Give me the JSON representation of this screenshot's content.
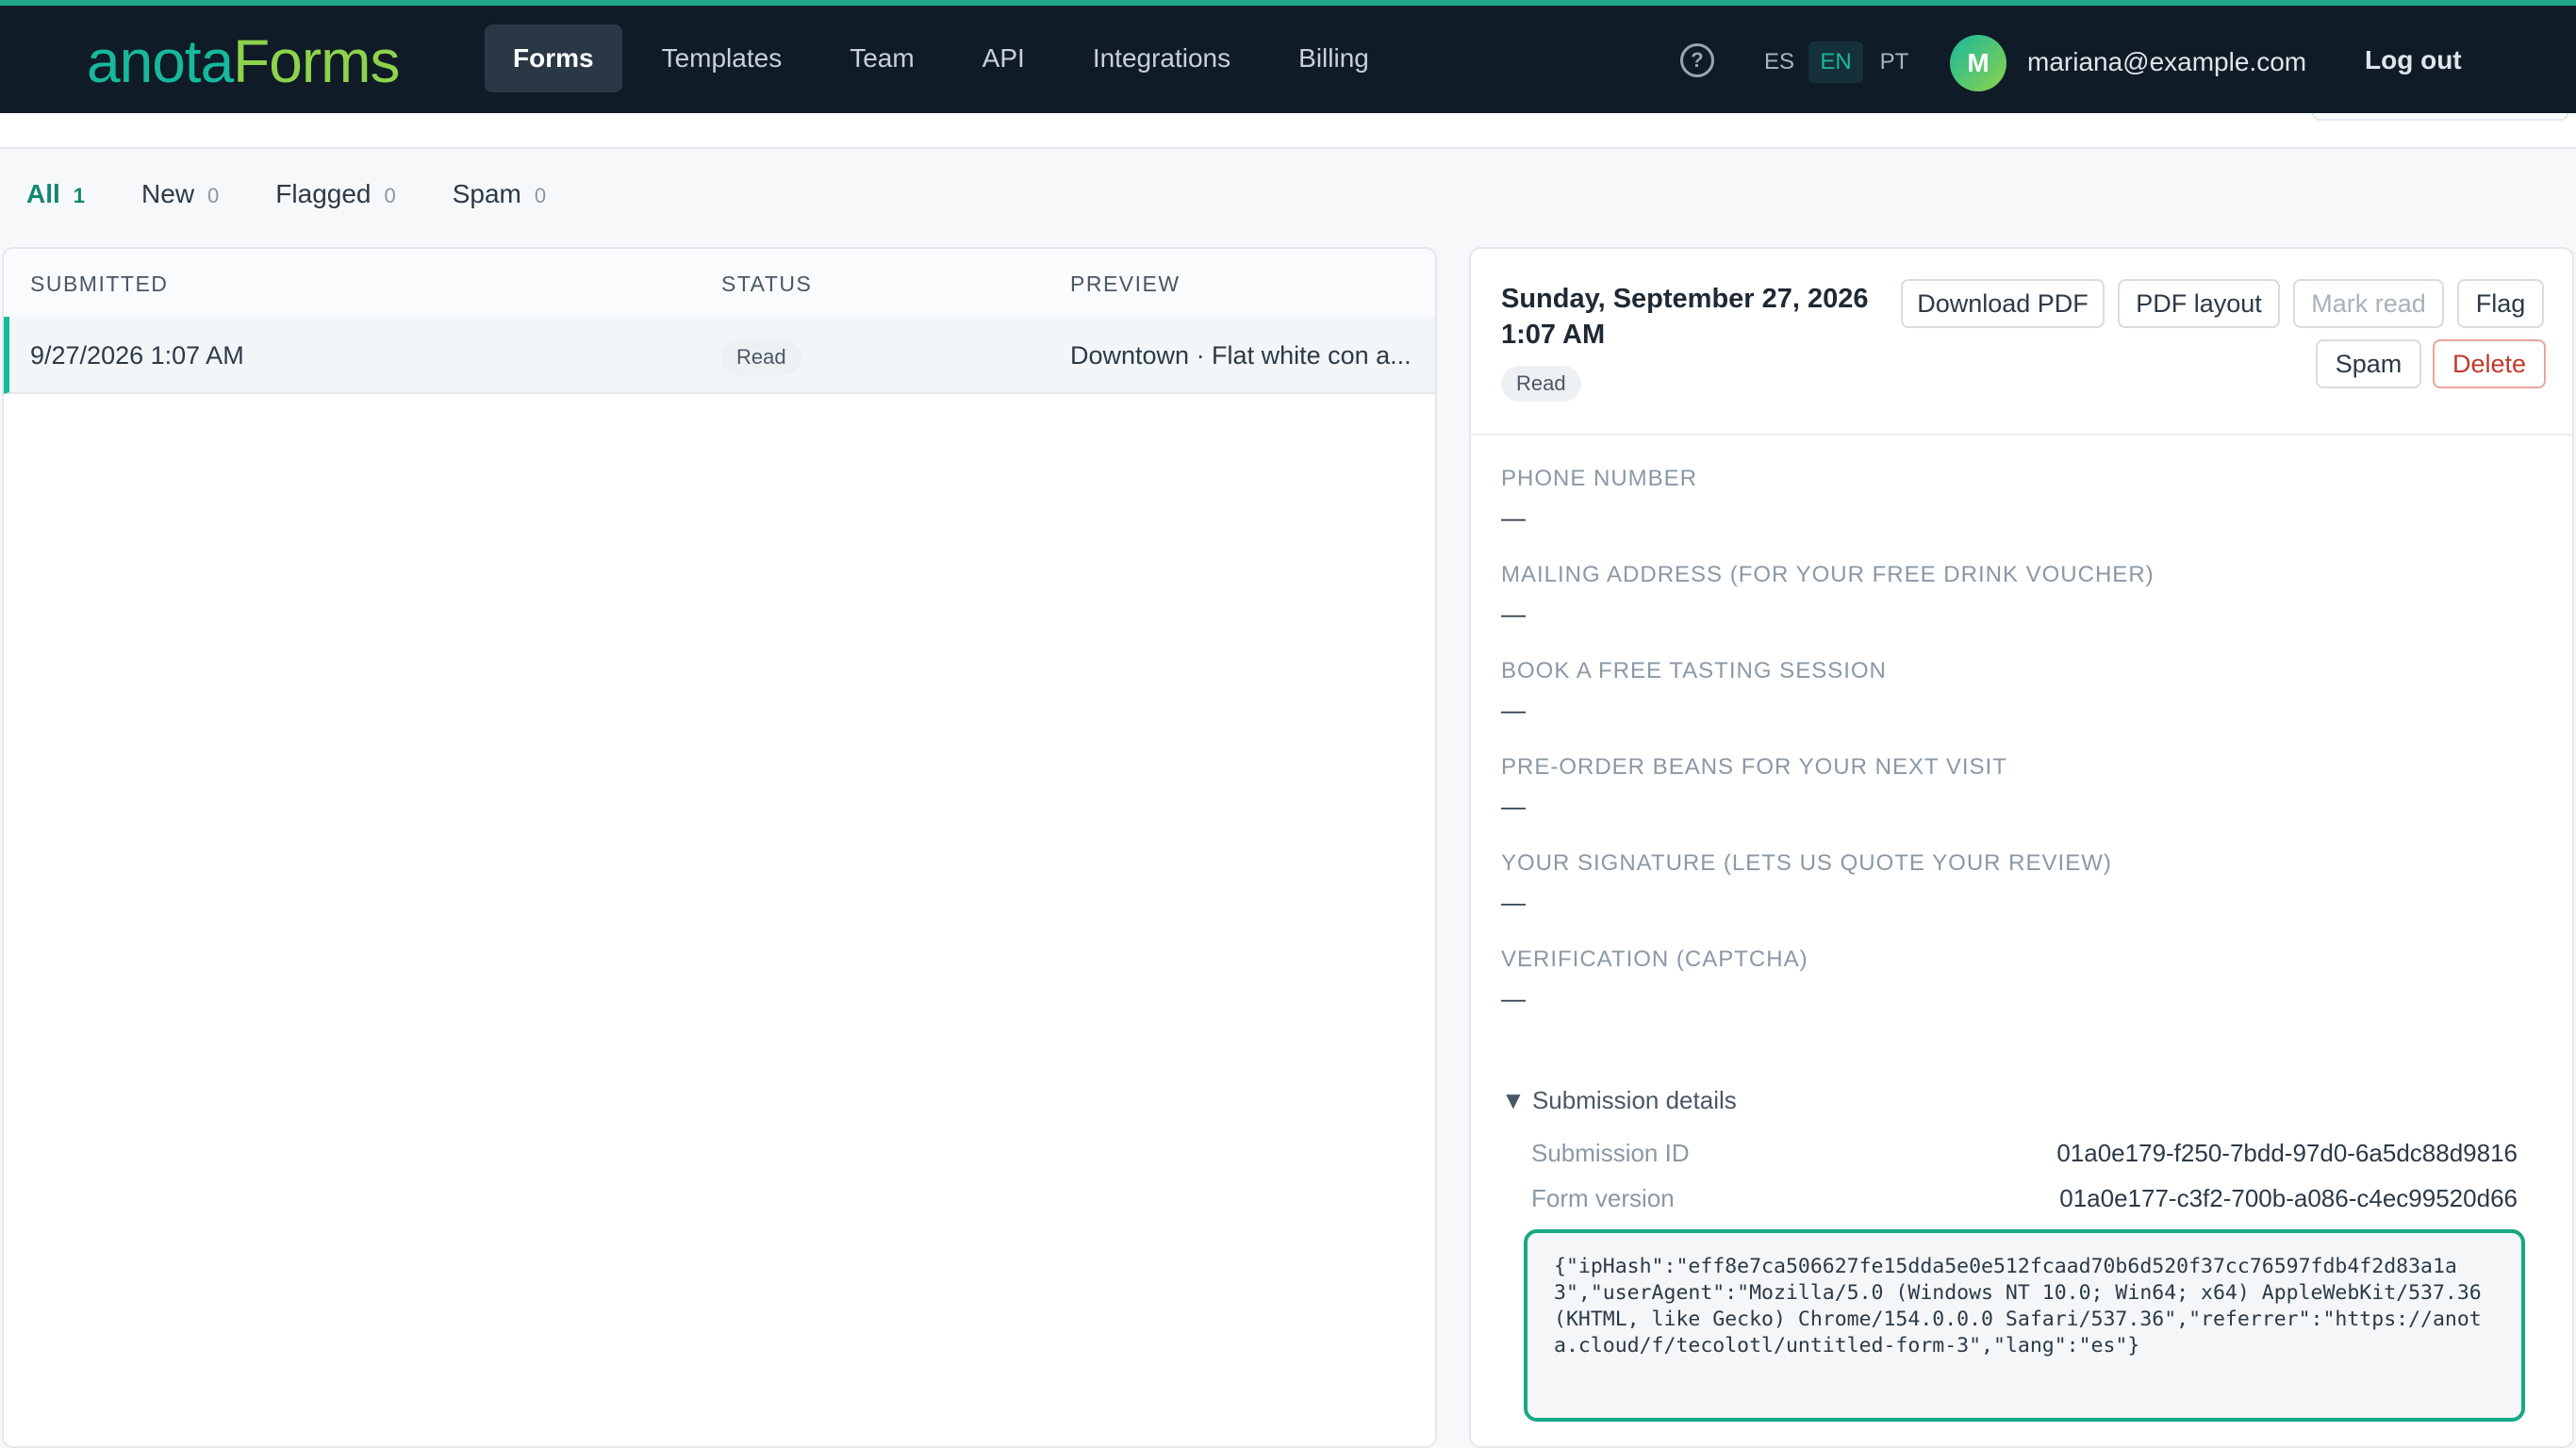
{
  "app": {
    "logo_part1": "anota",
    "logo_part2": "Forms"
  },
  "nav": {
    "forms": "Forms",
    "templates": "Templates",
    "team": "Team",
    "api": "API",
    "integrations": "Integrations",
    "billing": "Billing"
  },
  "header": {
    "help_glyph": "?",
    "lang_es": "ES",
    "lang_en": "EN",
    "lang_pt": "PT",
    "avatar_initial": "M",
    "email": "mariana@example.com",
    "logout": "Log out",
    "active_lang": "EN"
  },
  "filters": [
    {
      "label": "All",
      "count": "1"
    },
    {
      "label": "New",
      "count": "0"
    },
    {
      "label": "Flagged",
      "count": "0"
    },
    {
      "label": "Spam",
      "count": "0"
    }
  ],
  "table": {
    "headers": {
      "submitted": "SUBMITTED",
      "status": "STATUS",
      "preview": "PREVIEW"
    },
    "rows": [
      {
        "submitted": "9/27/2026 1:07 AM",
        "status": "Read",
        "preview": "Downtown · Flat white con a..."
      }
    ]
  },
  "detail": {
    "date_line1": "Sunday, September 27, 2026",
    "date_line2": "1:07 AM",
    "status": "Read",
    "buttons": {
      "download_pdf": "Download PDF",
      "pdf_layout": "PDF layout",
      "mark_read": "Mark read",
      "flag": "Flag",
      "spam": "Spam",
      "delete": "Delete"
    },
    "fields": [
      {
        "label": "PHONE NUMBER",
        "value": "—"
      },
      {
        "label": "MAILING ADDRESS (FOR YOUR FREE DRINK VOUCHER)",
        "value": "—"
      },
      {
        "label": "BOOK A FREE TASTING SESSION",
        "value": "—"
      },
      {
        "label": "PRE-ORDER BEANS FOR YOUR NEXT VISIT",
        "value": "—"
      },
      {
        "label": "YOUR SIGNATURE (LETS US QUOTE YOUR REVIEW)",
        "value": "—"
      },
      {
        "label": "VERIFICATION (CAPTCHA)",
        "value": "—"
      }
    ],
    "submission_details": {
      "toggle": "Submission details",
      "submission_id_label": "Submission ID",
      "submission_id": "01a0e179-f250-7bdd-97d0-6a5dc88d9816",
      "form_version_label": "Form version",
      "form_version": "01a0e177-c3f2-700b-a086-c4ec99520d66",
      "meta_json": "{\"ipHash\":\"eff8e7ca506627fe15dda5e0e512fcaad70b6d520f37cc76597fdb4f2d83a1a3\",\"userAgent\":\"Mozilla/5.0 (Windows NT 10.0; Win64; x64) AppleWebKit/537.36 (KHTML, like Gecko) Chrome/154.0.0.0 Safari/537.36\",\"referrer\":\"https://anota.cloud/f/tecolotl/untitled-form-3\",\"lang\":\"es\"}"
    }
  },
  "colors": {
    "topbar": "#0f1b26",
    "accent": "#17b89c",
    "logo_green": "#8fd24b",
    "danger": "#c0392b"
  }
}
